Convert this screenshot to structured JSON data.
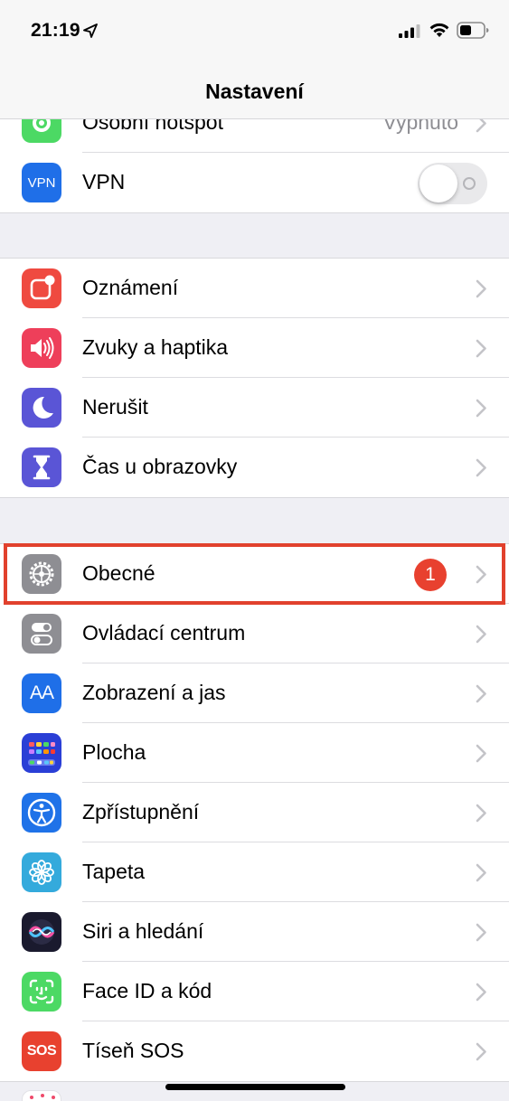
{
  "status_bar": {
    "time": "21:19",
    "icons": [
      "location-arrow-icon",
      "cellular-signal-icon",
      "wifi-icon",
      "battery-icon"
    ]
  },
  "nav": {
    "title": "Nastavení"
  },
  "groups": [
    {
      "rows": [
        {
          "label": "Osobní hotspot",
          "value": "Vypnuto",
          "icon": "hotspot-icon",
          "color": "#4cd964",
          "accessory": "chevron"
        },
        {
          "label": "VPN",
          "icon": "vpn-icon",
          "icon_text": "VPN",
          "color": "#1f6fe8",
          "accessory": "toggle",
          "toggle_on": false
        }
      ]
    },
    {
      "rows": [
        {
          "label": "Oznámení",
          "icon": "notifications-icon",
          "color": "#ef4a40",
          "accessory": "chevron"
        },
        {
          "label": "Zvuky a haptika",
          "icon": "speaker-icon",
          "color": "#ee3f5a",
          "accessory": "chevron"
        },
        {
          "label": "Nerušit",
          "icon": "moon-icon",
          "color": "#5a55d6",
          "accessory": "chevron"
        },
        {
          "label": "Čas u obrazovky",
          "icon": "hourglass-icon",
          "color": "#5a55d6",
          "accessory": "chevron"
        }
      ]
    },
    {
      "rows": [
        {
          "label": "Obecné",
          "icon": "gear-icon",
          "color": "#8e8e93",
          "accessory": "chevron",
          "badge": "1"
        },
        {
          "label": "Ovládací centrum",
          "icon": "control-center-icon",
          "color": "#8e8e93",
          "accessory": "chevron"
        },
        {
          "label": "Zobrazení a jas",
          "icon": "display-brightness-icon",
          "icon_text": "AA",
          "color": "#1f6fe8",
          "accessory": "chevron"
        },
        {
          "label": "Plocha",
          "icon": "home-screen-icon",
          "color": "#2a3fd6",
          "accessory": "chevron"
        },
        {
          "label": "Zpřístupnění",
          "icon": "accessibility-icon",
          "color": "#1f72e8",
          "accessory": "chevron"
        },
        {
          "label": "Tapeta",
          "icon": "wallpaper-icon",
          "color": "#34aadc",
          "accessory": "chevron"
        },
        {
          "label": "Siri a hledání",
          "icon": "siri-icon",
          "color": "#1a1a2e",
          "accessory": "chevron"
        },
        {
          "label": "Face ID a kód",
          "icon": "face-id-icon",
          "color": "#4cd964",
          "accessory": "chevron"
        },
        {
          "label": "Tíseň SOS",
          "icon": "sos-icon",
          "icon_text": "SOS",
          "color": "#e8412f",
          "accessory": "chevron"
        }
      ]
    }
  ],
  "colors": {
    "highlight": "#e1412d",
    "badge": "#e8412f",
    "background": "#efeff4"
  }
}
